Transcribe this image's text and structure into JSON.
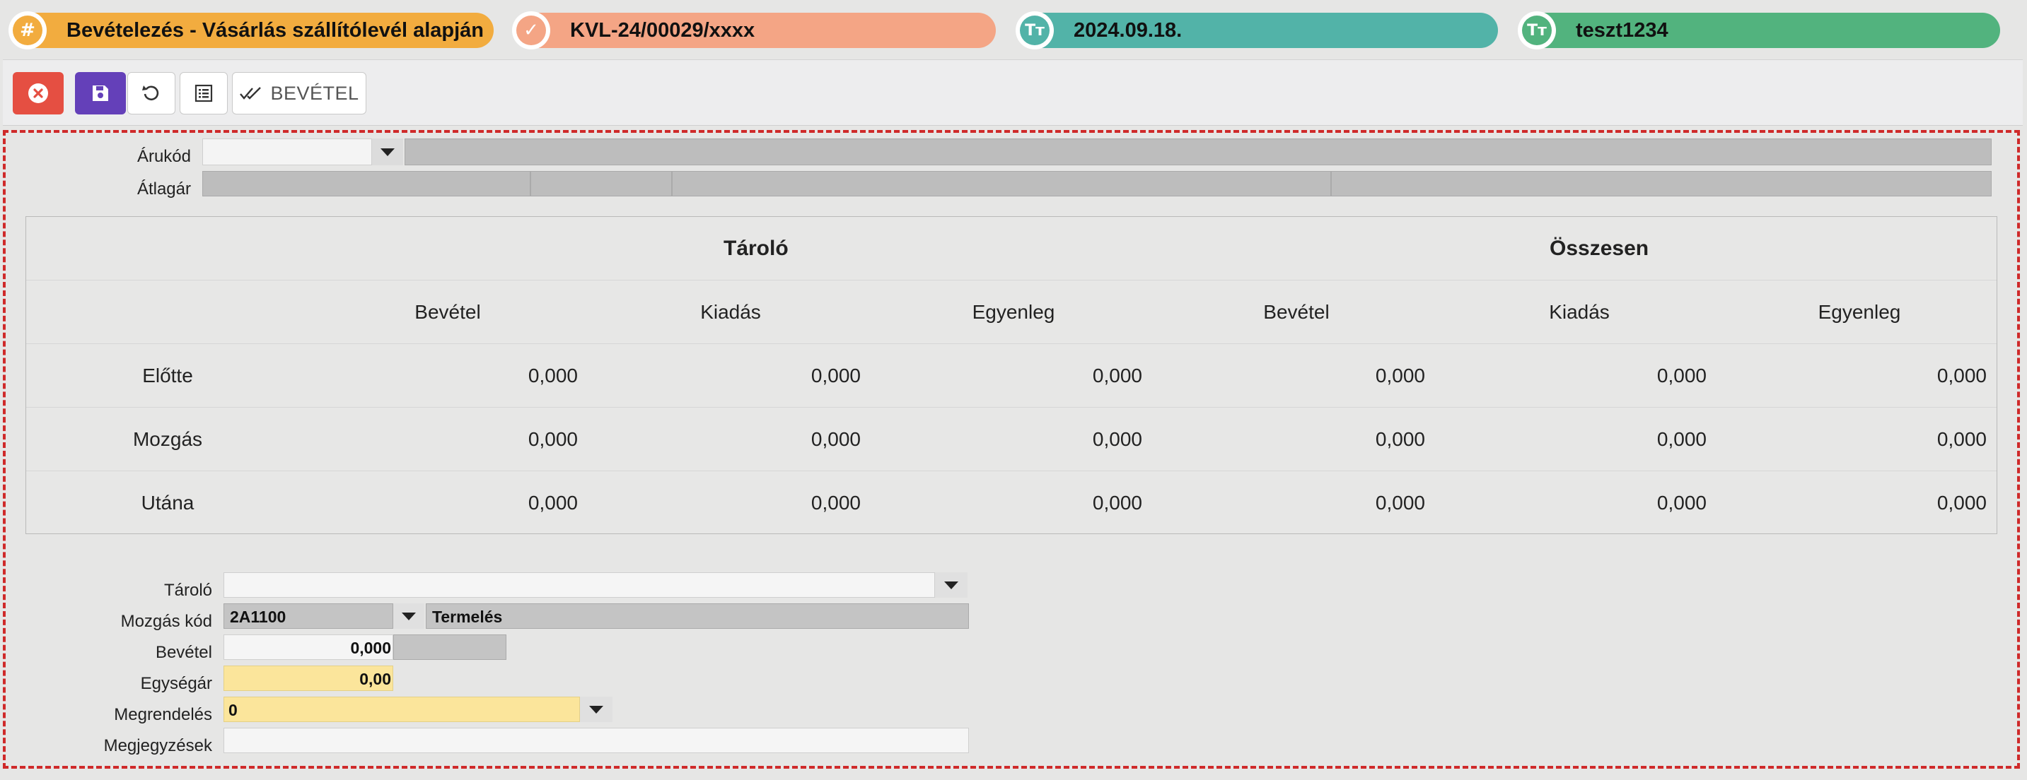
{
  "header": {
    "pills": [
      {
        "icon": "hash-icon",
        "glyph": "#",
        "text": "Bevételezés - Vásárlás szállítólevél alapján",
        "color": "#f2ac3f"
      },
      {
        "icon": "check-badge-icon",
        "glyph": "✓",
        "text": "KVL-24/00029/xxxx",
        "color": "#f4a585"
      },
      {
        "icon": "text-type-icon",
        "glyph": "Tт",
        "text": "2024.09.18.",
        "color": "#52b3a8"
      },
      {
        "icon": "text-type-icon",
        "glyph": "Tт",
        "text": "teszt1234",
        "color": "#52b37e"
      }
    ]
  },
  "toolbar": {
    "bevetel_label": "BEVÉTEL"
  },
  "top_fields": {
    "arukod_label": "Árukód",
    "arukod_value": "",
    "atlagar_label": "Átlagár"
  },
  "table": {
    "group_headers": [
      "Tároló",
      "Összesen"
    ],
    "column_headers": [
      "Bevétel",
      "Kiadás",
      "Egyenleg",
      "Bevétel",
      "Kiadás",
      "Egyenleg"
    ],
    "rows": [
      {
        "label": "Előtte",
        "values": [
          "0,000",
          "0,000",
          "0,000",
          "0,000",
          "0,000",
          "0,000"
        ]
      },
      {
        "label": "Mozgás",
        "values": [
          "0,000",
          "0,000",
          "0,000",
          "0,000",
          "0,000",
          "0,000"
        ]
      },
      {
        "label": "Utána",
        "values": [
          "0,000",
          "0,000",
          "0,000",
          "0,000",
          "0,000",
          "0,000"
        ]
      }
    ]
  },
  "form": {
    "tarolo_label": "Tároló",
    "tarolo_value": "",
    "mozgas_kod_label": "Mozgás kód",
    "mozgas_kod_value": "2A1100",
    "mozgas_kod_name": "Termelés",
    "bevetel_label": "Bevétel",
    "bevetel_value": "0,000",
    "egysegar_label": "Egységár",
    "egysegar_value": "0,00",
    "megrendeles_label": "Megrendelés",
    "megrendeles_value": "0",
    "megjegyzesek_label": "Megjegyzések",
    "megjegyzesek_value": ""
  },
  "colors": {
    "frame_border": "#cf2a2a",
    "close_button": "#e54f42",
    "save_button": "#6440b9",
    "required_field": "#fbe59b"
  }
}
